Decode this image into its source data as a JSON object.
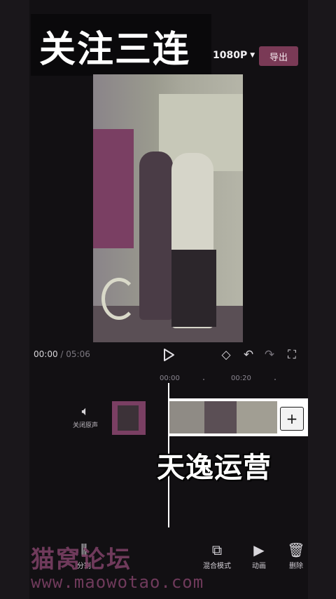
{
  "banner": {
    "title": "关注三连"
  },
  "header": {
    "resolution": "1080P",
    "export_label": "导出"
  },
  "player": {
    "current_time": "00:00",
    "separator": " / ",
    "duration": "05:06"
  },
  "timeline": {
    "ruler": [
      "00:00",
      "00:20"
    ],
    "mute_label": "关闭原声",
    "add_clip": "+"
  },
  "overlay": {
    "caption": "天逸运营"
  },
  "toolbar": {
    "items": [
      {
        "label": "分割",
        "icon": "split-icon"
      },
      {
        "label": "混合模式",
        "icon": "blend-mode-icon"
      },
      {
        "label": "动画",
        "icon": "animation-icon"
      },
      {
        "label": "删除",
        "icon": "delete-icon"
      }
    ]
  },
  "watermark": {
    "title": "猫窝论坛",
    "url": "www.maowotao.com"
  },
  "colors": {
    "accent": "#7a3a56",
    "background": "#121013"
  }
}
